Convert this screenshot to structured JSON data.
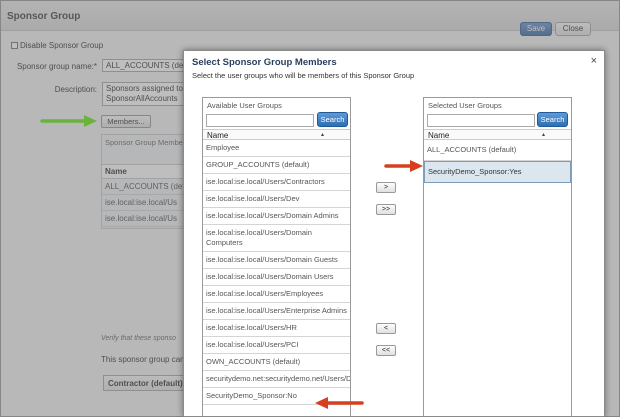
{
  "background_page": {
    "title": "Sponsor Group",
    "save_label": "Save",
    "close_label": "Close",
    "disable_label": "Disable Sponsor Group",
    "name_label": "Sponsor group name:*",
    "name_value": "ALL_ACCOUNTS (defa",
    "description_label": "Description:",
    "description_value": "Sponsors assigned to SponsorAllAccounts us",
    "members_button": "Members...",
    "table_title": "Sponsor Group Membe",
    "table_head": "Name",
    "table_rows": [
      "ALL_ACCOUNTS (defa",
      "ise.local:ise.local/Us",
      "ise.local:ise.local/Us"
    ],
    "verify_text": "Verify that these sponso",
    "can_text": "This sponsor group can",
    "contractor_label": "Contractor (default)"
  },
  "modal": {
    "title": "Select Sponsor Group Members",
    "subtitle": "Select the user groups who will be members of this Sponsor Group",
    "close_icon": "×",
    "available": {
      "caption": "Available User Groups",
      "search_label": "Search",
      "search_value": "",
      "column_header": "Name",
      "sort_indicator": "▴",
      "items": [
        "Employee",
        "GROUP_ACCOUNTS (default)",
        "ise.local:ise.local/Users/Contractors",
        "ise.local:ise.local/Users/Dev",
        "ise.local:ise.local/Users/Domain Admins",
        "ise.local:ise.local/Users/Domain Computers",
        "ise.local:ise.local/Users/Domain Guests",
        "ise.local:ise.local/Users/Domain Users",
        "ise.local:ise.local/Users/Employees",
        "ise.local:ise.local/Users/Enterprise Admins",
        "ise.local:ise.local/Users/HR",
        "ise.local:ise.local/Users/PCI",
        "OWN_ACCOUNTS (default)",
        "securitydemo.net:securitydemo.net/Users/Doctors",
        "SecurityDemo_Sponsor:No"
      ]
    },
    "selected": {
      "caption": "Selected User Groups",
      "search_label": "Search",
      "search_value": "",
      "column_header": "Name",
      "sort_indicator": "▴",
      "items": [
        "ALL_ACCOUNTS (default)",
        "SecurityDemo_Sponsor:Yes"
      ],
      "highlighted_index": 1
    },
    "move_buttons": {
      "add": ">",
      "add_all": ">>",
      "remove": "<",
      "remove_all": "<<"
    }
  },
  "colors": {
    "accent": "#3e6ea8",
    "red_arrow": "#d6401f",
    "green_arrow": "#6ab43e",
    "selected_row": "#dbe6ee"
  }
}
